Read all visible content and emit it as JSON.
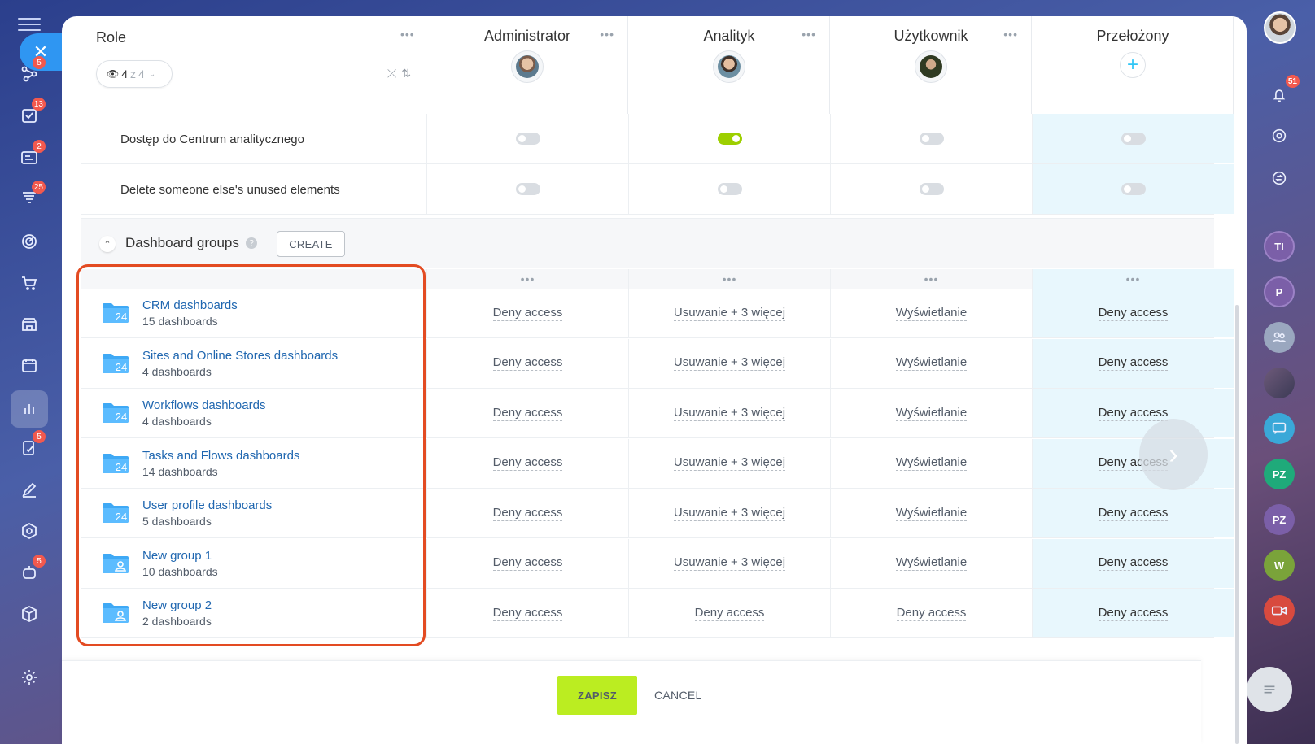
{
  "left_nav": {
    "items": [
      {
        "icon": "flow-icon",
        "badge": "5"
      },
      {
        "icon": "tasks-icon",
        "badge": "13"
      },
      {
        "icon": "feed-icon",
        "badge": "2"
      },
      {
        "icon": "funnel-icon",
        "badge": "25"
      },
      {
        "icon": "target-icon",
        "badge": ""
      },
      {
        "icon": "cart-icon",
        "badge": ""
      },
      {
        "icon": "store-icon",
        "badge": ""
      },
      {
        "icon": "calendar-icon",
        "badge": ""
      },
      {
        "icon": "analytics-icon",
        "badge": ""
      },
      {
        "icon": "sign-icon",
        "badge": "5"
      },
      {
        "icon": "pen-icon",
        "badge": ""
      },
      {
        "icon": "hexagon-icon",
        "badge": ""
      },
      {
        "icon": "robot-icon",
        "badge": "5"
      },
      {
        "icon": "box-icon",
        "badge": ""
      },
      {
        "icon": "settings-icon",
        "badge": ""
      }
    ]
  },
  "right_rail": {
    "notifications_badge": "51",
    "avatars": [
      "TI",
      "P",
      "PZ",
      "PZ",
      "W"
    ]
  },
  "header": {
    "role_title": "Role",
    "filter": {
      "current": "4",
      "sep": "z",
      "total": "4"
    },
    "roles": [
      {
        "name": "Administrator"
      },
      {
        "name": "Analityk"
      },
      {
        "name": "Użytkownik"
      },
      {
        "name": "Przełożony"
      }
    ]
  },
  "permissions": [
    {
      "label": "Dostęp do Centrum analitycznego",
      "states": [
        false,
        true,
        false,
        false
      ]
    },
    {
      "label": "Delete someone else's unused elements",
      "states": [
        false,
        false,
        false,
        false
      ]
    }
  ],
  "section": {
    "title": "Dashboard groups",
    "help": "?",
    "create_label": "CREATE"
  },
  "groups": [
    {
      "name": "CRM dashboards",
      "count": "15 dashboards",
      "folder_type": "24",
      "access": [
        "Deny access",
        "Usuwanie + 3 więcej",
        "Wyświetlanie",
        "Deny access"
      ]
    },
    {
      "name": "Sites and Online Stores dashboards",
      "count": "4 dashboards",
      "folder_type": "24",
      "access": [
        "Deny access",
        "Usuwanie + 3 więcej",
        "Wyświetlanie",
        "Deny access"
      ]
    },
    {
      "name": "Workflows dashboards",
      "count": "4 dashboards",
      "folder_type": "24",
      "access": [
        "Deny access",
        "Usuwanie + 3 więcej",
        "Wyświetlanie",
        "Deny access"
      ]
    },
    {
      "name": "Tasks and Flows dashboards",
      "count": "14 dashboards",
      "folder_type": "24",
      "access": [
        "Deny access",
        "Usuwanie + 3 więcej",
        "Wyświetlanie",
        "Deny access"
      ]
    },
    {
      "name": "User profile dashboards",
      "count": "5 dashboards",
      "folder_type": "24",
      "access": [
        "Deny access",
        "Usuwanie + 3 więcej",
        "Wyświetlanie",
        "Deny access"
      ]
    },
    {
      "name": "New group 1",
      "count": "10 dashboards",
      "folder_type": "user",
      "access": [
        "Deny access",
        "Usuwanie + 3 więcej",
        "Wyświetlanie",
        "Deny access"
      ]
    },
    {
      "name": "New group 2",
      "count": "2 dashboards",
      "folder_type": "user",
      "access": [
        "Deny access",
        "Deny access",
        "Deny access",
        "Deny access"
      ]
    }
  ],
  "footer": {
    "save_label": "ZAPISZ",
    "cancel_label": "CANCEL"
  },
  "colors": {
    "accent_blue": "#2f96f2",
    "toggle_on": "#9dcf00",
    "save_green": "#bbed21",
    "highlight_col": "#e8f7fd",
    "annotation_red": "#e34b22",
    "link_blue": "#2067b0"
  }
}
